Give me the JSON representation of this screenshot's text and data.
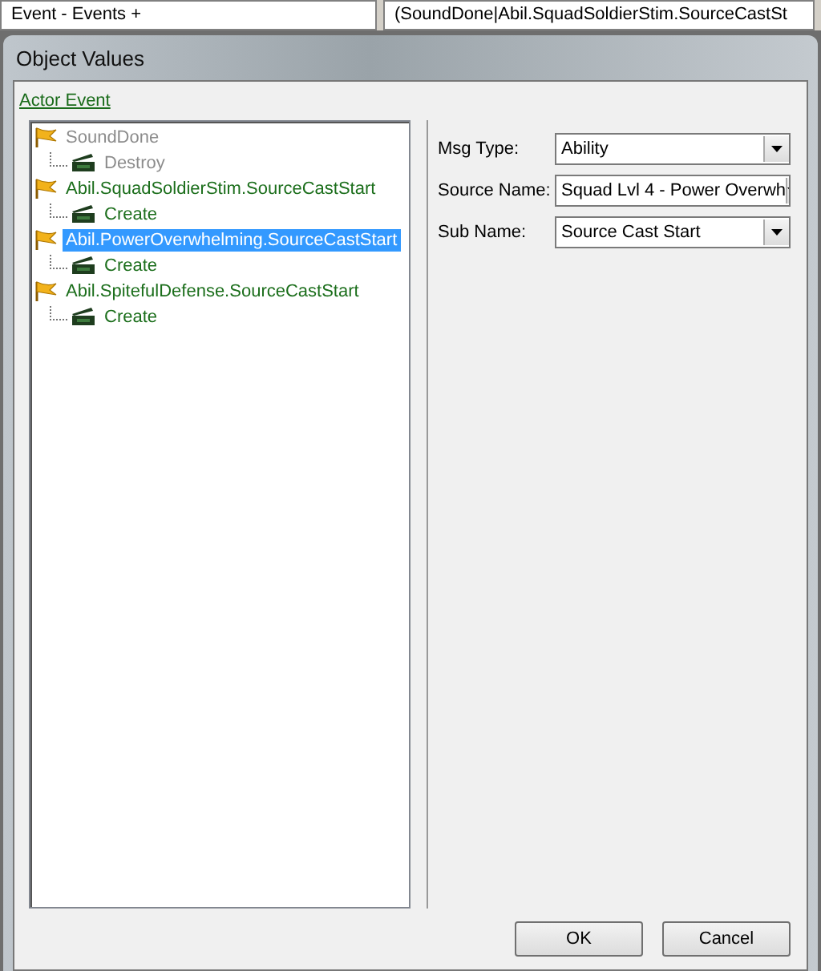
{
  "top_bar": {
    "cells": [
      "Event - Events +",
      "(SoundDone|Abil.SquadSoldierStim.SourceCastSt"
    ]
  },
  "window": {
    "title": "Object Values"
  },
  "link": "Actor Event",
  "tree": [
    {
      "label": "SoundDone",
      "disabled": true,
      "selected": false,
      "children": [
        {
          "label": "Destroy",
          "disabled": true,
          "selected": false
        }
      ]
    },
    {
      "label": "Abil.SquadSoldierStim.SourceCastStart",
      "disabled": false,
      "selected": false,
      "children": [
        {
          "label": "Create",
          "disabled": false,
          "selected": false
        }
      ]
    },
    {
      "label": "Abil.PowerOverwhelming.SourceCastStart",
      "disabled": false,
      "selected": true,
      "children": [
        {
          "label": "Create",
          "disabled": false,
          "selected": false
        }
      ]
    },
    {
      "label": "Abil.SpitefulDefense.SourceCastStart",
      "disabled": false,
      "selected": false,
      "children": [
        {
          "label": "Create",
          "disabled": false,
          "selected": false
        }
      ]
    }
  ],
  "fields": [
    {
      "label": "Msg Type:",
      "value": "Ability"
    },
    {
      "label": "Source Name:",
      "value": "Squad Lvl 4 - Power Overwh"
    },
    {
      "label": "Sub Name:",
      "value": "Source Cast Start"
    }
  ],
  "buttons": [
    "OK",
    "Cancel"
  ]
}
